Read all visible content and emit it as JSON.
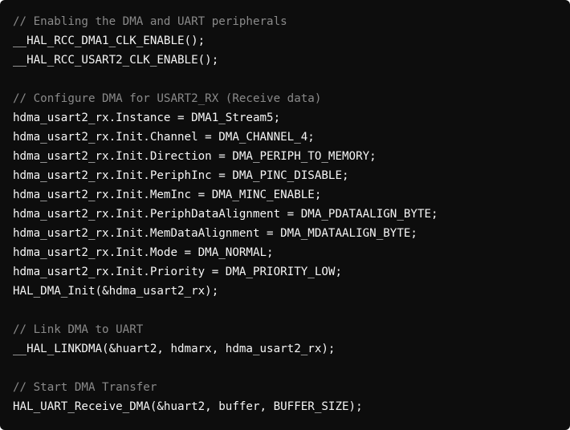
{
  "colors": {
    "background": "#0d0d0d",
    "code_text": "#f5f5f5",
    "comment_text": "#8a8a8a"
  },
  "code": {
    "lines": [
      {
        "type": "comment",
        "text": "// Enabling the DMA and UART peripherals"
      },
      {
        "type": "code",
        "text": "__HAL_RCC_DMA1_CLK_ENABLE();"
      },
      {
        "type": "code",
        "text": "__HAL_RCC_USART2_CLK_ENABLE();"
      },
      {
        "type": "blank",
        "text": ""
      },
      {
        "type": "comment",
        "text": "// Configure DMA for USART2_RX (Receive data)"
      },
      {
        "type": "code",
        "text": "hdma_usart2_rx.Instance = DMA1_Stream5;"
      },
      {
        "type": "code",
        "text": "hdma_usart2_rx.Init.Channel = DMA_CHANNEL_4;"
      },
      {
        "type": "code",
        "text": "hdma_usart2_rx.Init.Direction = DMA_PERIPH_TO_MEMORY;"
      },
      {
        "type": "code",
        "text": "hdma_usart2_rx.Init.PeriphInc = DMA_PINC_DISABLE;"
      },
      {
        "type": "code",
        "text": "hdma_usart2_rx.Init.MemInc = DMA_MINC_ENABLE;"
      },
      {
        "type": "code",
        "text": "hdma_usart2_rx.Init.PeriphDataAlignment = DMA_PDATAALIGN_BYTE;"
      },
      {
        "type": "code",
        "text": "hdma_usart2_rx.Init.MemDataAlignment = DMA_MDATAALIGN_BYTE;"
      },
      {
        "type": "code",
        "text": "hdma_usart2_rx.Init.Mode = DMA_NORMAL;"
      },
      {
        "type": "code",
        "text": "hdma_usart2_rx.Init.Priority = DMA_PRIORITY_LOW;"
      },
      {
        "type": "code",
        "text": "HAL_DMA_Init(&hdma_usart2_rx);"
      },
      {
        "type": "blank",
        "text": ""
      },
      {
        "type": "comment",
        "text": "// Link DMA to UART"
      },
      {
        "type": "code",
        "text": "__HAL_LINKDMA(&huart2, hdmarx, hdma_usart2_rx);"
      },
      {
        "type": "blank",
        "text": ""
      },
      {
        "type": "comment",
        "text": "// Start DMA Transfer"
      },
      {
        "type": "code",
        "text": "HAL_UART_Receive_DMA(&huart2, buffer, BUFFER_SIZE);"
      }
    ]
  }
}
